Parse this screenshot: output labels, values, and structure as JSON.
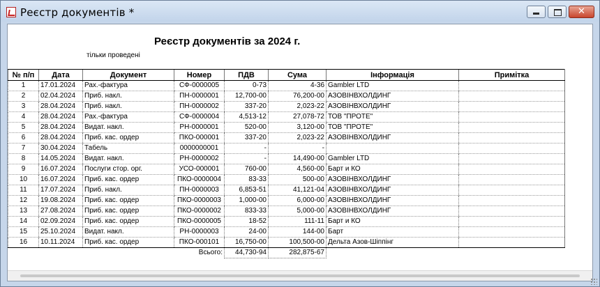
{
  "window": {
    "title": "Реєстр документів  *"
  },
  "report": {
    "title": "Реєстр документів за 2024 г.",
    "subtitle": "тільки проведені"
  },
  "table": {
    "headers": [
      "№ п/п",
      "Дата",
      "Документ",
      "Номер",
      "ПДВ",
      "Сума",
      "Інформація",
      "Примітка"
    ],
    "rows": [
      [
        "1",
        "17.01.2024",
        "Рах.-фактура",
        "СФ-0000005",
        "0-73",
        "4-36",
        "Gambler LTD",
        ""
      ],
      [
        "2",
        "02.04.2024",
        "Приб. накл.",
        "ПН-0000001",
        "12,700-00",
        "76,200-00",
        "АЗОВІНВХОЛДИНГ",
        ""
      ],
      [
        "3",
        "28.04.2024",
        "Приб. накл.",
        "ПН-0000002",
        "337-20",
        "2,023-22",
        "АЗОВІНВХОЛДИНГ",
        ""
      ],
      [
        "4",
        "28.04.2024",
        "Рах.-фактура",
        "СФ-0000004",
        "4,513-12",
        "27,078-72",
        "ТОВ \"ПРОТЕ\"",
        ""
      ],
      [
        "5",
        "28.04.2024",
        "Видат. накл.",
        "РН-0000001",
        "520-00",
        "3,120-00",
        "ТОВ \"ПРОТЕ\"",
        ""
      ],
      [
        "6",
        "28.04.2024",
        "Приб. кас. ордер",
        "ПКО-000001",
        "337-20",
        "2,023-22",
        "АЗОВІНВХОЛДИНГ",
        ""
      ],
      [
        "7",
        "30.04.2024",
        "Табель",
        "0000000001",
        "-",
        "-",
        "",
        ""
      ],
      [
        "8",
        "14.05.2024",
        "Видат. накл.",
        "РН-0000002",
        "-",
        "14,490-00",
        "Gambler LTD",
        ""
      ],
      [
        "9",
        "16.07.2024",
        "Послуги стор. орг.",
        "УСО-000001",
        "760-00",
        "4,560-00",
        "Барт и КО",
        ""
      ],
      [
        "10",
        "16.07.2024",
        "Приб. кас. ордер",
        "ПКО-0000004",
        "83-33",
        "500-00",
        "АЗОВІНВХОЛДИНГ",
        ""
      ],
      [
        "11",
        "17.07.2024",
        "Приб. накл.",
        "ПН-0000003",
        "6,853-51",
        "41,121-04",
        "АЗОВІНВХОЛДИНГ",
        ""
      ],
      [
        "12",
        "19.08.2024",
        "Приб. кас. ордер",
        "ПКО-0000003",
        "1,000-00",
        "6,000-00",
        "АЗОВІНВХОЛДИНГ",
        ""
      ],
      [
        "13",
        "27.08.2024",
        "Приб. кас. ордер",
        "ПКО-0000002",
        "833-33",
        "5,000-00",
        "АЗОВІНВХОЛДИНГ",
        ""
      ],
      [
        "14",
        "02.09.2024",
        "Приб. кас. ордер",
        "ПКО-0000005",
        "18-52",
        "111-11",
        "Барт и КО",
        ""
      ],
      [
        "15",
        "25.10.2024",
        "Видат. накл.",
        "РН-0000003",
        "24-00",
        "144-00",
        "Барт",
        ""
      ],
      [
        "16",
        "10.11.2024",
        "Приб. кас. ордер",
        "ПКО-000101",
        "16,750-00",
        "100,500-00",
        "Дельта Азов-Шіппінг",
        ""
      ]
    ],
    "total": {
      "label": "Всього:",
      "vat": "44,730-94",
      "sum": "282,875-67"
    }
  }
}
